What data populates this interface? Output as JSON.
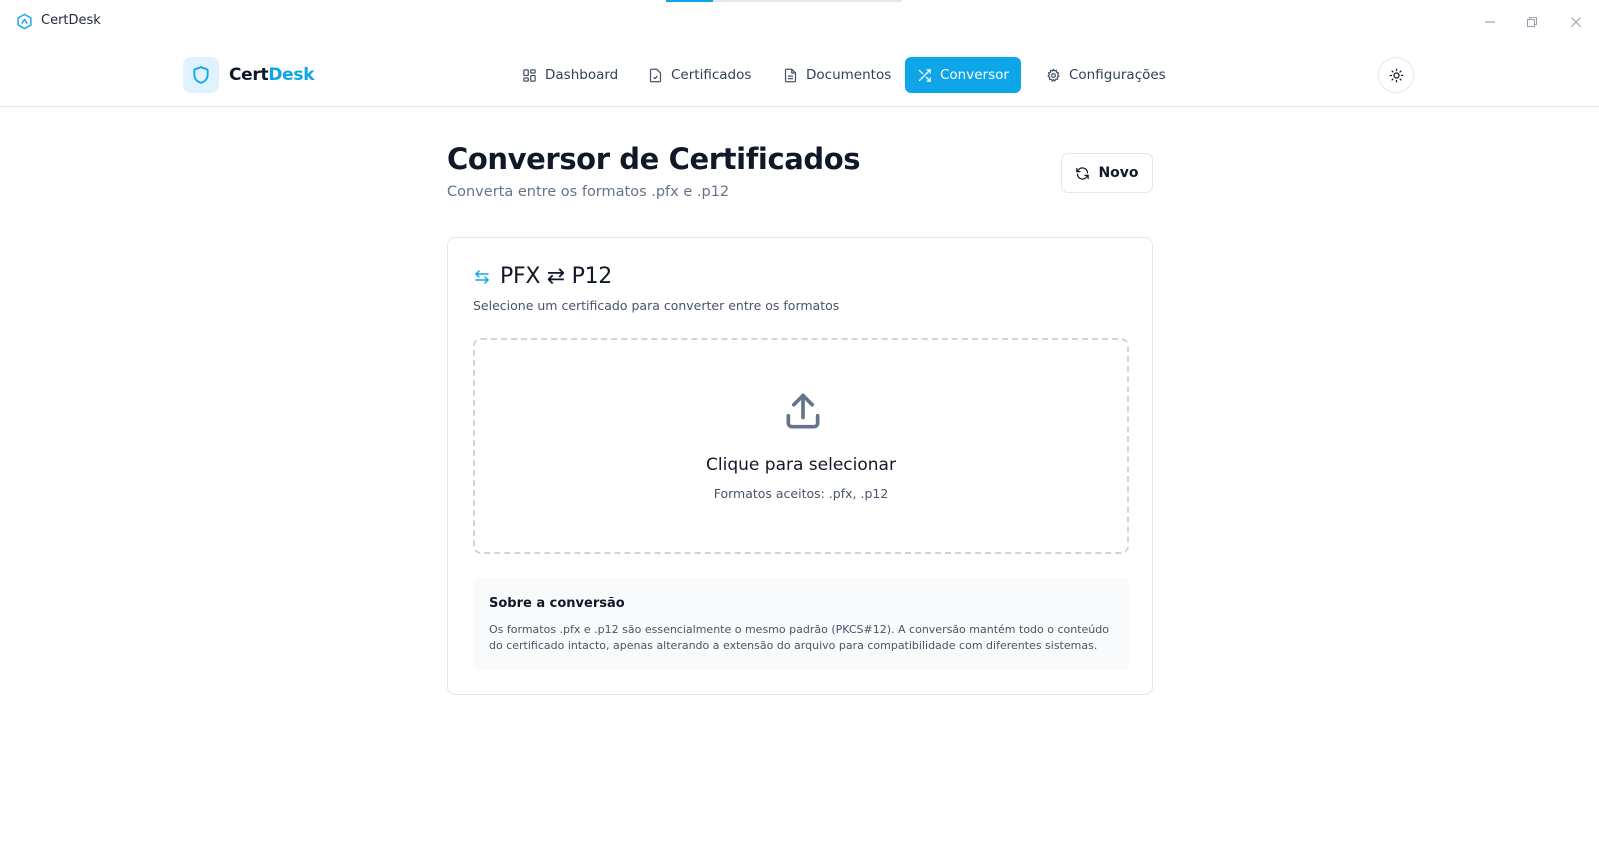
{
  "window": {
    "title": "CertDesk",
    "loading_progress": 0.2,
    "minimize": "minimize",
    "restore": "restore",
    "close": "close"
  },
  "brand": {
    "part1": "Cert",
    "part2": "Desk",
    "accent_color": "#0ea5e9"
  },
  "nav": {
    "items": [
      {
        "label": "Dashboard",
        "icon": "dashboard-icon"
      },
      {
        "label": "Certificados",
        "icon": "file-check-icon"
      },
      {
        "label": "Documentos",
        "icon": "document-icon"
      },
      {
        "label": "Conversor",
        "icon": "shuffle-icon",
        "active": true
      },
      {
        "label": "Configurações",
        "icon": "gear-icon"
      }
    ],
    "theme_toggle_icon": "sun-icon"
  },
  "page": {
    "title": "Conversor de Certificados",
    "subtitle": "Converta entre os formatos .pfx e .p12",
    "new_button": "Novo"
  },
  "card": {
    "title": "PFX ⇄ P12",
    "description": "Selecione um certificado para converter entre os formatos",
    "dropzone": {
      "title": "Clique para selecionar",
      "subtitle": "Formatos aceitos: .pfx, .p12"
    },
    "info": {
      "title": "Sobre a conversão",
      "text": "Os formatos .pfx e .p12 são essencialmente o mesmo padrão (PKCS#12). A conversão mantém todo o conteúdo do certificado intacto, apenas alterando a extensão do arquivo para compatibilidade com diferentes sistemas."
    }
  }
}
